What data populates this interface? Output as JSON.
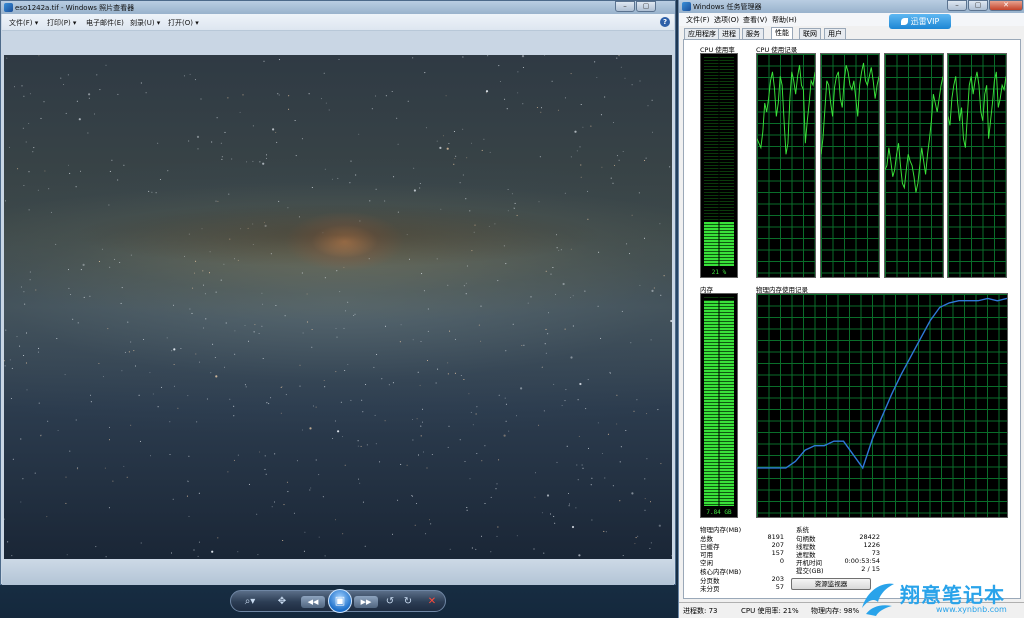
{
  "viewer": {
    "title": "eso1242a.tif - Windows 照片查看器",
    "menu": [
      "文件(F) ▾",
      "打印(P) ▾",
      "电子邮件(E)",
      "刻录(U) ▾",
      "打开(O) ▾"
    ],
    "help": "?",
    "controls": {
      "zoom": "⌕▾",
      "fit": "✥",
      "prev": "◀◀",
      "slideshow": "▣",
      "next": "▶▶",
      "rotate_ccw": "↺",
      "rotate_cw": "↻",
      "delete": "✕"
    }
  },
  "taskmgr": {
    "title": "Windows 任务管理器",
    "menu": [
      "文件(F)",
      "选项(O)",
      "查看(V)",
      "帮助(H)"
    ],
    "vip_label": "迅雷VIP",
    "tabs": [
      "应用程序",
      "进程",
      "服务",
      "性能",
      "联网",
      "用户"
    ],
    "active_tab": "性能",
    "cpu_usage_label": "CPU 使用率",
    "cpu_usage_value": "21 %",
    "cpu_usage_fraction": 0.21,
    "cpu_history_label": "CPU 使用记录",
    "mem_label": "内存",
    "mem_value": "7.84 GB",
    "mem_fraction": 0.98,
    "mem_history_label": "物理内存使用记录",
    "physical_memory": {
      "title": "物理内存(MB)",
      "rows": [
        {
          "k": "总数",
          "v": "8191"
        },
        {
          "k": "已缓存",
          "v": "207"
        },
        {
          "k": "可用",
          "v": "157"
        },
        {
          "k": "空闲",
          "v": "0"
        }
      ]
    },
    "kernel_memory": {
      "title": "核心内存(MB)",
      "rows": [
        {
          "k": "分页数",
          "v": "203"
        },
        {
          "k": "未分页",
          "v": "57"
        }
      ]
    },
    "system": {
      "title": "系统",
      "rows": [
        {
          "k": "句柄数",
          "v": "28422"
        },
        {
          "k": "线程数",
          "v": "1226"
        },
        {
          "k": "进程数",
          "v": "73"
        },
        {
          "k": "开机时间",
          "v": "0:00:53:54"
        },
        {
          "k": "提交(GB)",
          "v": "2 / 15"
        }
      ]
    },
    "resource_monitor_button": "资源监视器",
    "status": {
      "processes": "进程数: 73",
      "cpu": "CPU 使用率: 21%",
      "memory": "物理内存: 98%"
    }
  },
  "watermark": {
    "title": "翔意笔记本",
    "url": "www.xynbnb.com"
  },
  "colors": {
    "graph_line": "#39e23a",
    "mem_line": "#2f78d8",
    "grid": "#0a6d2a"
  },
  "cpu_history": [
    [
      0.62,
      0.6,
      0.58,
      0.65,
      0.78,
      0.74,
      0.8,
      0.88,
      0.92,
      0.85,
      0.72,
      0.78,
      0.9,
      0.86,
      0.7,
      0.55,
      0.6,
      0.8,
      0.92,
      0.88,
      0.82,
      0.9,
      0.95,
      0.86,
      0.84,
      0.6,
      0.7,
      0.78,
      0.88,
      0.86,
      0.92
    ],
    [
      0.55,
      0.62,
      0.75,
      0.88,
      0.86,
      0.78,
      0.72,
      0.85,
      0.9,
      0.92,
      0.8,
      0.76,
      0.88,
      0.95,
      0.92,
      0.86,
      0.84,
      0.88,
      0.8,
      0.72,
      0.86,
      0.92,
      0.96,
      0.88,
      0.86,
      0.9,
      0.94,
      0.88,
      0.8,
      0.86,
      0.9
    ],
    [
      0.48,
      0.5,
      0.58,
      0.52,
      0.45,
      0.48,
      0.55,
      0.6,
      0.5,
      0.42,
      0.4,
      0.48,
      0.55,
      0.52,
      0.5,
      0.45,
      0.38,
      0.42,
      0.5,
      0.58,
      0.52,
      0.46,
      0.55,
      0.62,
      0.7,
      0.82,
      0.78,
      0.74,
      0.8,
      0.86,
      0.9
    ],
    [
      0.72,
      0.68,
      0.8,
      0.86,
      0.9,
      0.78,
      0.7,
      0.76,
      0.62,
      0.58,
      0.72,
      0.86,
      0.9,
      0.82,
      0.88,
      0.92,
      0.86,
      0.74,
      0.7,
      0.82,
      0.86,
      0.62,
      0.7,
      0.78,
      0.88,
      0.92,
      0.76,
      0.8,
      0.86,
      0.84,
      0.9
    ]
  ],
  "mem_history": [
    0.22,
    0.22,
    0.22,
    0.22,
    0.25,
    0.3,
    0.32,
    0.32,
    0.34,
    0.34,
    0.28,
    0.22,
    0.35,
    0.45,
    0.55,
    0.64,
    0.72,
    0.8,
    0.88,
    0.94,
    0.96,
    0.97,
    0.97,
    0.97,
    0.98,
    0.97,
    0.98
  ]
}
